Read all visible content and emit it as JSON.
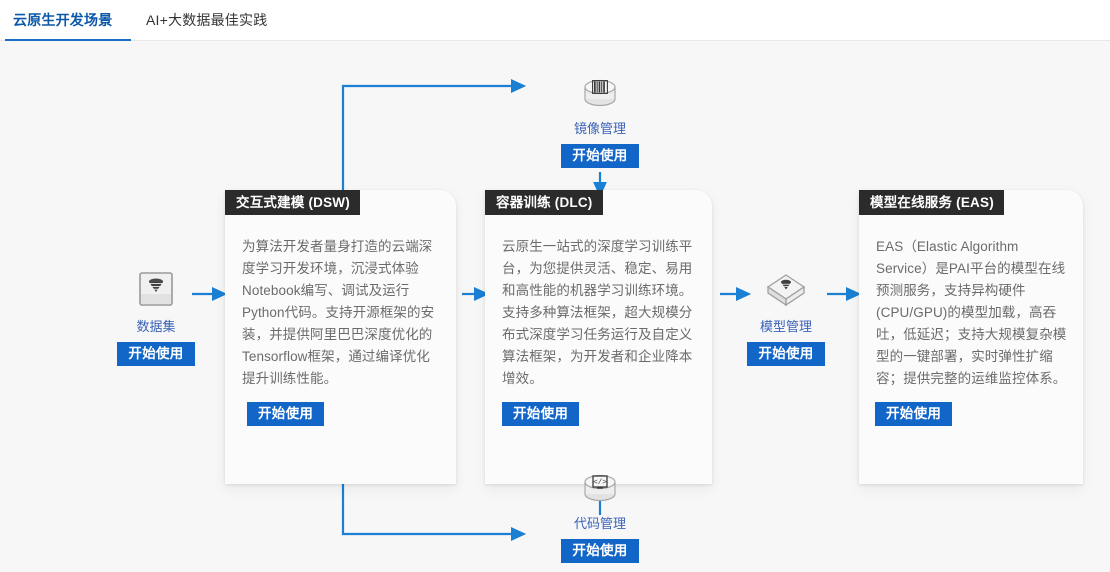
{
  "tabs": [
    {
      "label": "云原生开发场景",
      "active": true,
      "name": "tab-cloud-native-dev"
    },
    {
      "label": "AI+大数据最佳实践",
      "active": false,
      "name": "tab-ai-bigdata-best-practice"
    }
  ],
  "colors": {
    "accent_blue": "#1266c8",
    "tab_active_text": "#0b58a8",
    "tab_underline": "#1a6fc4",
    "card_header_bg": "#2b2b2b",
    "node_label": "#3b63b8",
    "canvas_bg": "#f7f7f7",
    "card_bg": "#fbfbfb",
    "wire_blue": "#1b7fd4",
    "desc_text": "#6b6b6b"
  },
  "common": {
    "cta_label": "开始使用"
  },
  "cards": [
    {
      "name": "card-dsw",
      "title": "交互式建模 (DSW)",
      "description": "为算法开发者量身打造的云端深度学习开发环境，沉浸式体验Notebook编写、调试及运行Python代码。支持开源框架的安装，并提供阿里巴巴深度优化的Tensorflow框架，通过编译优化提升训练性能。",
      "cta_label": "开始使用"
    },
    {
      "name": "card-dlc",
      "title": "容器训练 (DLC)",
      "description": "云原生一站式的深度学习训练平台，为您提供灵活、稳定、易用和高性能的机器学习训练环境。支持多种算法框架，超大规模分布式深度学习任务运行及自定义算法框架，为开发者和企业降本增效。",
      "cta_label": "开始使用"
    },
    {
      "name": "card-eas",
      "title": "模型在线服务 (EAS)",
      "description": "EAS（Elastic Algorithm Service）是PAI平台的模型在线预测服务，支持异构硬件(CPU/GPU)的模型加载，高吞吐，低延迟；支持大规模复杂模型的一键部署，实时弹性扩缩容；提供完整的运维监控体系。",
      "cta_label": "开始使用"
    }
  ],
  "nodes": [
    {
      "name": "node-dataset",
      "label": "数据集",
      "icon": "dataset-stack-icon",
      "cta_label": "开始使用"
    },
    {
      "name": "node-image-management",
      "label": "镜像管理",
      "icon": "image-disc-icon",
      "cta_label": "开始使用"
    },
    {
      "name": "node-code-management",
      "label": "代码管理",
      "icon": "code-disc-icon",
      "cta_label": "开始使用"
    },
    {
      "name": "node-model-management",
      "label": "模型管理",
      "icon": "model-cube-icon",
      "cta_label": "开始使用"
    }
  ],
  "connectors": [
    {
      "name": "wire-dataset-to-dsw",
      "from": "node-dataset",
      "to": "card-dsw",
      "direction": "right"
    },
    {
      "name": "wire-dsw-to-dlc",
      "from": "card-dsw",
      "to": "card-dlc",
      "direction": "right"
    },
    {
      "name": "wire-dlc-to-model",
      "from": "card-dlc",
      "to": "node-model-management",
      "direction": "right"
    },
    {
      "name": "wire-model-to-eas",
      "from": "node-model-management",
      "to": "card-eas",
      "direction": "right"
    },
    {
      "name": "wire-dsw-top-to-image",
      "from": "card-dsw",
      "to": "node-image-management",
      "direction": "up-right"
    },
    {
      "name": "wire-image-to-dlc",
      "from": "node-image-management",
      "to": "card-dlc",
      "direction": "down"
    },
    {
      "name": "wire-dsw-bottom-to-code",
      "from": "card-dsw",
      "to": "node-code-management",
      "direction": "down-right"
    },
    {
      "name": "wire-code-to-dlc",
      "from": "node-code-management",
      "to": "card-dlc",
      "direction": "up"
    }
  ]
}
